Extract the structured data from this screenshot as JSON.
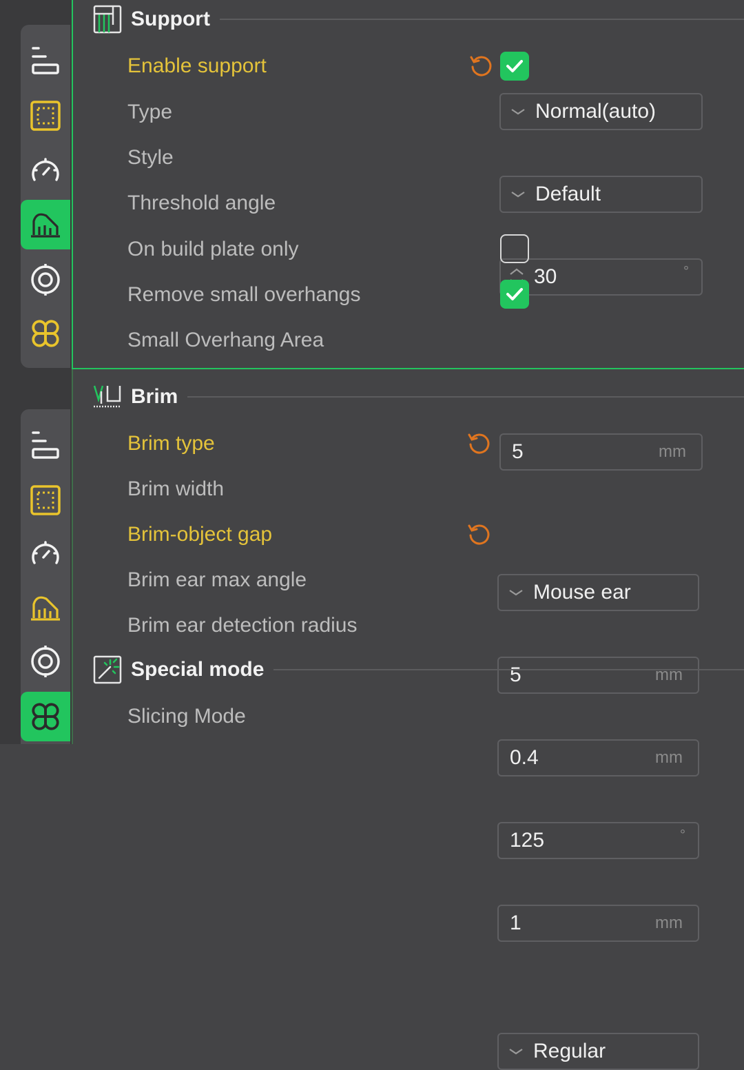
{
  "colors": {
    "accent": "#22c55e",
    "modified": "#e4c33a",
    "reset": "#e0751f",
    "icon_yellow": "#e9c42c"
  },
  "sidebar_icons": [
    "quality-icon",
    "strength-icon",
    "speed-icon",
    "support-icon",
    "others-icon",
    "advanced-icon"
  ],
  "support": {
    "title": "Support",
    "enable_support": {
      "label": "Enable support",
      "checked": true
    },
    "type": {
      "label": "Type",
      "value": "Normal(auto)"
    },
    "style": {
      "label": "Style",
      "value": "Default"
    },
    "threshold_angle": {
      "label": "Threshold angle",
      "value": "30",
      "unit": "°"
    },
    "build_plate_only": {
      "label": "On build plate only",
      "checked": false
    },
    "remove_small_overhangs": {
      "label": "Remove small overhangs",
      "checked": true
    },
    "small_overhang_area": {
      "label": "Small Overhang Area",
      "value": "5",
      "unit": "mm"
    }
  },
  "brim": {
    "title": "Brim",
    "brim_type": {
      "label": "Brim type",
      "value": "Mouse ear"
    },
    "brim_width": {
      "label": "Brim width",
      "value": "5",
      "unit": "mm"
    },
    "brim_object_gap": {
      "label": "Brim-object gap",
      "value": "0.4",
      "unit": "mm"
    },
    "brim_ear_max_angle": {
      "label": "Brim ear max angle",
      "value": "125",
      "unit": "°"
    },
    "brim_ear_detection_radius": {
      "label": "Brim ear detection radius",
      "value": "1",
      "unit": "mm"
    }
  },
  "special_mode": {
    "title": "Special mode",
    "slicing_mode": {
      "label": "Slicing Mode",
      "value": "Regular"
    }
  }
}
